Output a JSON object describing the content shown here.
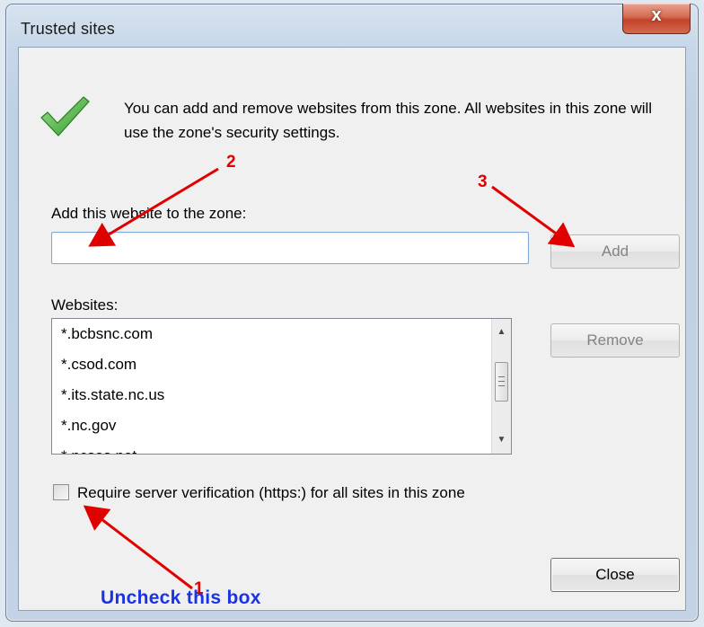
{
  "window": {
    "title": "Trusted sites",
    "close_glyph": "x"
  },
  "info": {
    "text": "You can add and remove websites from this zone. All websites in this zone will use the zone's security settings.",
    "icon": "green-checkmark-icon"
  },
  "add_site": {
    "label": "Add this website to the zone:",
    "input_value": "",
    "button_label": "Add"
  },
  "websites": {
    "label": "Websites:",
    "items": [
      "*.bcbsnc.com",
      "*.csod.com",
      "*.its.state.nc.us",
      "*.nc.gov",
      "*.ncsos.net"
    ],
    "remove_label": "Remove"
  },
  "verification": {
    "label": "Require server verification (https:) for all sites in this zone",
    "checked": false
  },
  "close_label": "Close",
  "annotations": {
    "step1": "1",
    "step2": "2",
    "step3": "3",
    "instruction": "Uncheck this box",
    "arrow_color": "#e00000",
    "instruction_color": "#1a33e6"
  }
}
